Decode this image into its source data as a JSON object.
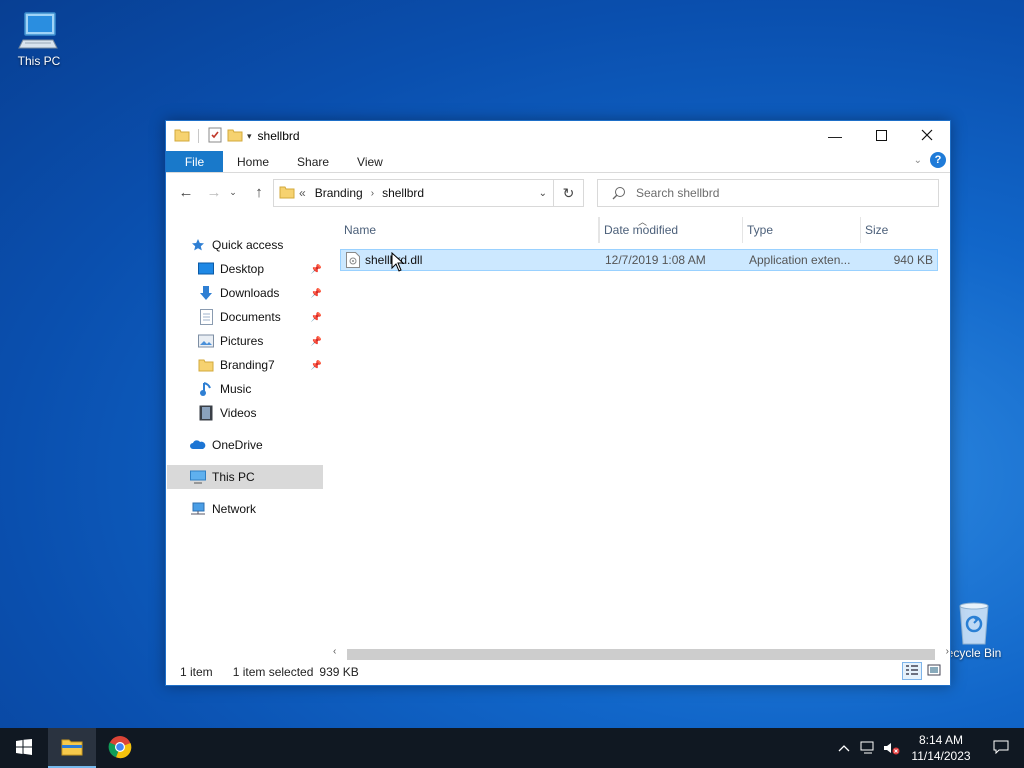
{
  "desktop": {
    "this_pc_label": "This PC",
    "recycle_bin_label": "ecycle Bin"
  },
  "window": {
    "title": "shellbrd",
    "ribbon_tabs": [
      "File",
      "Home",
      "Share",
      "View"
    ],
    "address": {
      "overflow": "«",
      "crumbs": [
        "Branding",
        "shellbrd"
      ]
    },
    "search_placeholder": "Search shellbrd"
  },
  "nav_pane": {
    "quick_access": "Quick access",
    "items": [
      {
        "label": "Desktop",
        "icon": "desktop-icon",
        "pinned": true
      },
      {
        "label": "Downloads",
        "icon": "downloads-icon",
        "pinned": true
      },
      {
        "label": "Documents",
        "icon": "documents-icon",
        "pinned": true
      },
      {
        "label": "Pictures",
        "icon": "pictures-icon",
        "pinned": true
      },
      {
        "label": "Branding7",
        "icon": "folder-icon",
        "pinned": true
      },
      {
        "label": "Music",
        "icon": "music-icon",
        "pinned": false
      },
      {
        "label": "Videos",
        "icon": "videos-icon",
        "pinned": false
      }
    ],
    "onedrive": "OneDrive",
    "this_pc": "This PC",
    "network": "Network"
  },
  "file_list": {
    "columns": [
      "Name",
      "Date modified",
      "Type",
      "Size"
    ],
    "rows": [
      {
        "name": "shellbrd.dll",
        "date": "12/7/2019 1:08 AM",
        "type": "Application exten...",
        "size": "940 KB",
        "selected": true
      }
    ]
  },
  "status": {
    "count": "1 item",
    "selection": "1 item selected",
    "selection_size": "939 KB"
  },
  "taskbar": {
    "time": "8:14 AM",
    "date": "11/14/2023"
  },
  "colors": {
    "accent": "#1979ca",
    "selection_bg": "#cce8ff",
    "taskbar": "#101822"
  }
}
